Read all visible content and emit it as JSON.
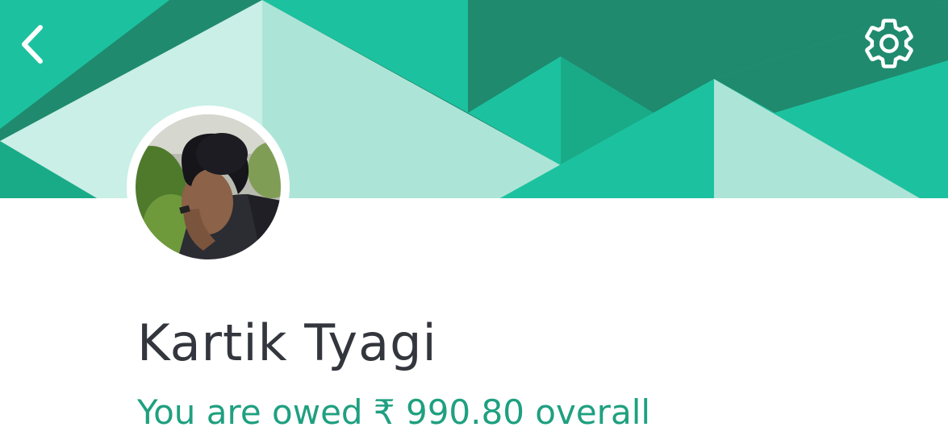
{
  "header": {
    "back_icon": "chevron-left-icon",
    "settings_icon": "gear-icon",
    "colors": {
      "dark_green": "#1f8a6e",
      "teal": "#1cc29f",
      "mid_teal": "#19ab88",
      "light_mint": "#ace5d7",
      "pale_mint": "#c9efe6"
    }
  },
  "profile": {
    "name": "Kartik Tyagi",
    "balance_text": "You are owed ₹ 990.80 overall",
    "balance_color": "#1fa080"
  }
}
